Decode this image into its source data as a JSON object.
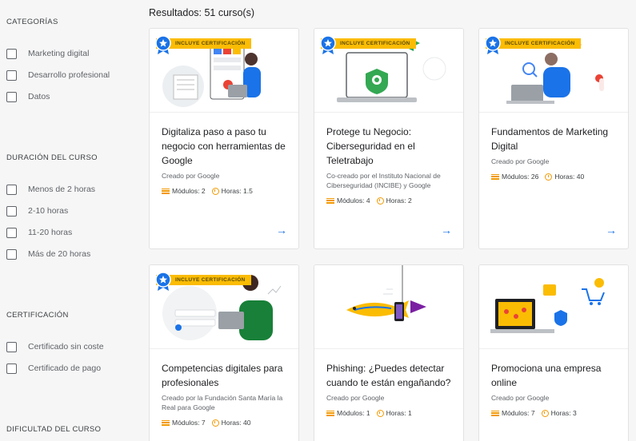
{
  "filters": {
    "categories": {
      "title": "CATEGORÍAS",
      "options": [
        "Marketing digital",
        "Desarrollo profesional",
        "Datos"
      ]
    },
    "duration": {
      "title": "DURACIÓN DEL CURSO",
      "options": [
        "Menos de 2 horas",
        "2-10 horas",
        "11-20 horas",
        "Más de 20 horas"
      ]
    },
    "certification": {
      "title": "CERTIFICACIÓN",
      "options": [
        "Certificado sin coste",
        "Certificado de pago"
      ]
    },
    "difficulty": {
      "title": "DIFICULTAD DEL CURSO"
    }
  },
  "results_label": "Resultados: 51 curso(s)",
  "badge_text": "INCLUYE CERTIFICACIÓN",
  "modules_label": "Módulos:",
  "hours_label": "Horas:",
  "colors": {
    "accent": "#1a73e8",
    "badge": "#fbbc04",
    "icon": "#f29900"
  },
  "courses": [
    {
      "title": "Digitaliza paso a paso tu negocio con herramientas de Google",
      "by": "Creado por Google",
      "modules": "2",
      "hours": "1.5",
      "certified": true
    },
    {
      "title": "Protege tu Negocio: Ciberseguridad en el Teletrabajo",
      "by": "Co-creado por el Instituto Nacional de Ciberseguridad (INCIBE) y Google",
      "modules": "4",
      "hours": "2",
      "certified": true
    },
    {
      "title": "Fundamentos de Marketing Digital",
      "by": "Creado por Google",
      "modules": "26",
      "hours": "40",
      "certified": true
    },
    {
      "title": "Competencias digitales para profesionales",
      "by": "Creado por la Fundación Santa María la Real para Google",
      "modules": "7",
      "hours": "40",
      "certified": true
    },
    {
      "title": "Phishing: ¿Puedes detectar cuando te están engañando?",
      "by": "Creado por Google",
      "modules": "1",
      "hours": "1",
      "certified": false
    },
    {
      "title": "Promociona una empresa online",
      "by": "Creado por Google",
      "modules": "7",
      "hours": "3",
      "certified": false
    }
  ]
}
